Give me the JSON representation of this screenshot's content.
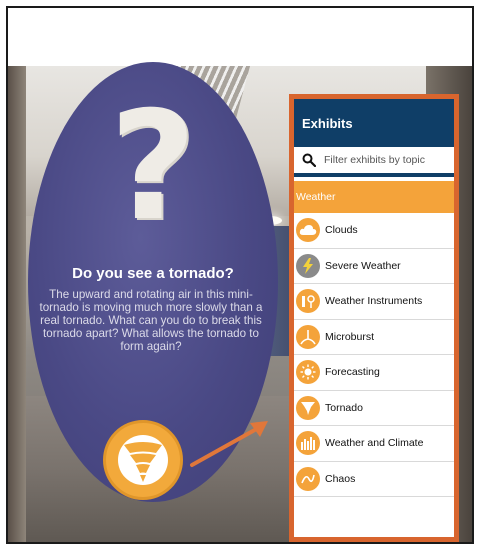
{
  "sign": {
    "symbol": "?",
    "title": "Do you see a tornado?",
    "body": "The upward and rotating air in this mini-tornado is moving much more slowly than a real tornado. What can you do to break this tornado apart? What allows the tornado to form again?"
  },
  "panel": {
    "title": "Exhibits",
    "search": {
      "placeholder": "Filter exhibits by topic",
      "value": ""
    },
    "section": "Weather",
    "items": [
      {
        "label": "Clouds",
        "icon": "cloud-icon"
      },
      {
        "label": "Severe Weather",
        "icon": "lightning-icon"
      },
      {
        "label": "Weather Instruments",
        "icon": "instruments-icon"
      },
      {
        "label": "Microburst",
        "icon": "microburst-icon"
      },
      {
        "label": "Forecasting",
        "icon": "sun-icon"
      },
      {
        "label": "Tornado",
        "icon": "tornado-icon"
      },
      {
        "label": "Weather and Climate",
        "icon": "bars-icon"
      },
      {
        "label": "Chaos",
        "icon": "chaos-icon"
      }
    ]
  },
  "colors": {
    "header": "#0f3e67",
    "accent": "#f4a33a",
    "panel_border": "#d8652e",
    "sign": "#4a4985"
  }
}
